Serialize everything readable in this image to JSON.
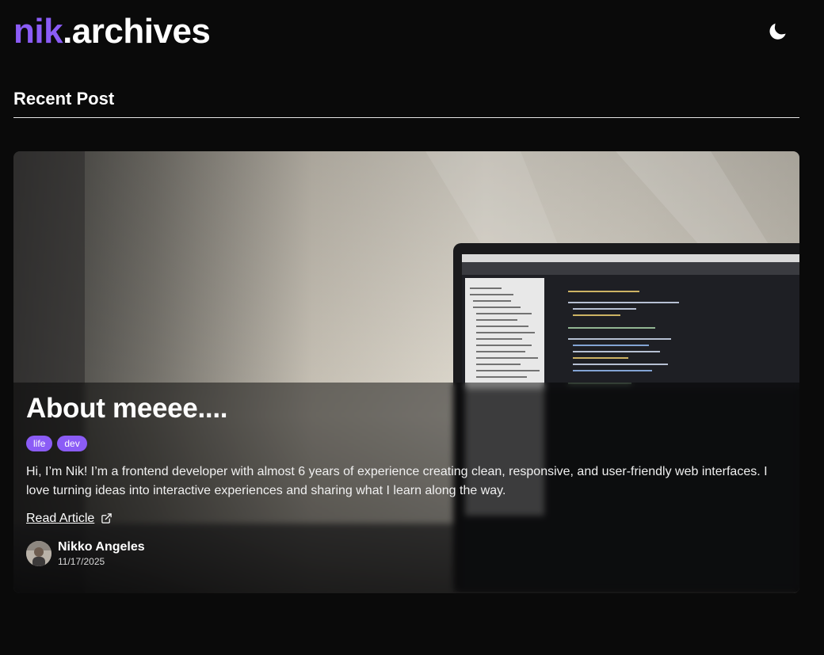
{
  "header": {
    "logo_accent": "nik",
    "logo_rest": ".archives",
    "theme_toggle_icon": "moon-icon"
  },
  "section": {
    "title": "Recent Post"
  },
  "post": {
    "title": "About meeee....",
    "tags": [
      "life",
      "dev"
    ],
    "excerpt": "Hi, I’m Nik! I’m a frontend developer with almost 6 years of experience creating clean, responsive, and user-friendly web interfaces. I love turning ideas into interactive experiences and sharing what I learn along the way.",
    "read_label": "Read Article",
    "read_icon": "external-link-icon",
    "image_description_icon": "laptop-code-image",
    "author": {
      "name": "Nikko Angeles",
      "date": "11/17/2025"
    }
  },
  "colors": {
    "background": "#0a0a0a",
    "accent": "#8b5cf6",
    "text": "#ffffff"
  }
}
